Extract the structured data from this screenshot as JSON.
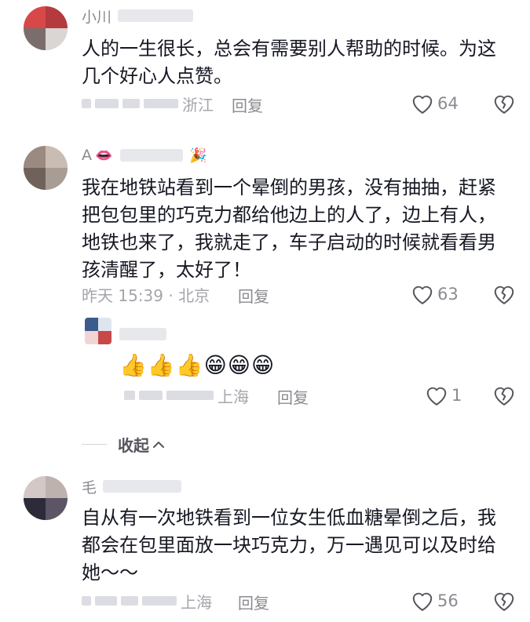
{
  "comments": [
    {
      "name": "小川",
      "text": "人的一生很长，总会有需要别人帮助的时候。为这几个好心人点赞。",
      "location": "浙江",
      "reply_label": "回复",
      "likes": "64"
    },
    {
      "name": "A",
      "name_emoji": "👄",
      "tag_emoji": "🎉",
      "text": "我在地铁站看到一个晕倒的男孩，没有抽抽，赶紧把包包里的巧克力都给他边上的人了，边上有人，地铁也来了，我就走了，车子启动的时候就看看男孩清醒了，太好了！",
      "time": "昨天 15:39 · 北京",
      "reply_label": "回复",
      "likes": "63"
    },
    {
      "text": "👍👍👍😁😁😁",
      "location": "上海",
      "reply_label": "回复",
      "likes": "1"
    },
    {
      "name": "毛",
      "text": "自从有一次地铁看到一位女生低血糖晕倒之后，我都会在包里面放一块巧克力，万一遇见可以及时给她～～",
      "location": "上海",
      "reply_label": "回复",
      "likes": "56"
    }
  ],
  "collapse_label": "收起",
  "colors": {
    "text": "#161823",
    "secondary": "#8a8b91",
    "muted": "#a4a5ab"
  }
}
